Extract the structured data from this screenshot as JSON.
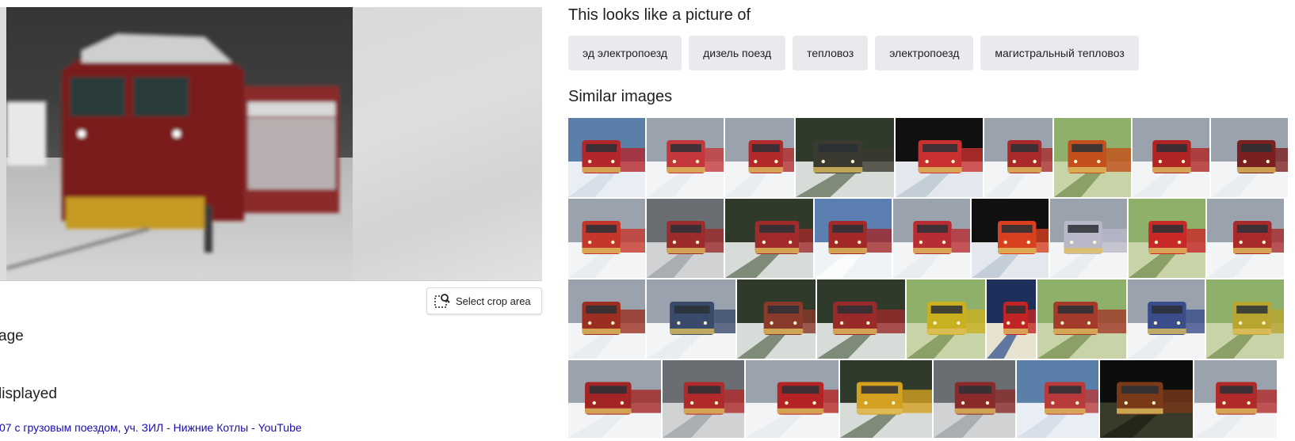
{
  "preview": {
    "crop_button_label": "Select crop area"
  },
  "left_panel": {
    "heading_1": "age",
    "heading_2": "lisplayed",
    "source_link": "07 с грузовым поездом, уч. ЗИЛ - Нижние Котлы - YouTube"
  },
  "labels_section": {
    "title": "This looks like a picture of",
    "chips": [
      {
        "label": "эд электропоезд"
      },
      {
        "label": "дизель поезд"
      },
      {
        "label": "тепловоз"
      },
      {
        "label": "электропоезд"
      },
      {
        "label": "магистральный тепловоз"
      }
    ]
  },
  "similar_section": {
    "title": "Similar images",
    "rows": [
      [
        {
          "theme": "blue-snow",
          "accent": "#b3262b"
        },
        {
          "theme": "snow",
          "accent": "#c4373a"
        },
        {
          "theme": "snow",
          "accent": "#b32a2a"
        },
        {
          "theme": "forest",
          "accent": "#3b3a30"
        },
        {
          "theme": "dark-frame",
          "accent": "#c93131"
        },
        {
          "theme": "snow",
          "accent": "#a82a2a"
        },
        {
          "theme": "summer",
          "accent": "#c3501c"
        },
        {
          "theme": "snow",
          "accent": "#b02424"
        },
        {
          "theme": "snow",
          "accent": "#7a2020"
        }
      ],
      [
        {
          "theme": "snow",
          "accent": "#c4362b"
        },
        {
          "theme": "storm",
          "accent": "#9c2b2b"
        },
        {
          "theme": "forest",
          "accent": "#a12b2b"
        },
        {
          "theme": "mountain",
          "accent": "#a32828"
        },
        {
          "theme": "snow",
          "accent": "#b82c33"
        },
        {
          "theme": "dark-frame",
          "accent": "#d84020"
        },
        {
          "theme": "snow",
          "accent": "#b8b8c8"
        },
        {
          "theme": "summer",
          "accent": "#c82828"
        },
        {
          "theme": "snow",
          "accent": "#a82a2a"
        }
      ],
      [
        {
          "theme": "snow",
          "accent": "#9b2e20"
        },
        {
          "theme": "snow",
          "accent": "#3a4a6a"
        },
        {
          "theme": "forest",
          "accent": "#8a3a2a"
        },
        {
          "theme": "forest",
          "accent": "#9a2a2a"
        },
        {
          "theme": "summer",
          "accent": "#c9b020"
        },
        {
          "theme": "poster",
          "accent": "#c12424"
        },
        {
          "theme": "summer",
          "accent": "#a33a2a"
        },
        {
          "theme": "snow",
          "accent": "#3a4c8a"
        },
        {
          "theme": "summer",
          "accent": "#b8a530"
        }
      ],
      [
        {
          "theme": "snow",
          "accent": "#a32424"
        },
        {
          "theme": "storm",
          "accent": "#b02a2a"
        },
        {
          "theme": "snow",
          "accent": "#b52424"
        },
        {
          "theme": "forest",
          "accent": "#d3a020"
        },
        {
          "theme": "storm",
          "accent": "#8a2a2a"
        },
        {
          "theme": "blue-snow",
          "accent": "#b83a3a"
        },
        {
          "theme": "night",
          "accent": "#7a3a1a"
        },
        {
          "theme": "snow",
          "accent": "#b02a2a"
        }
      ]
    ]
  }
}
